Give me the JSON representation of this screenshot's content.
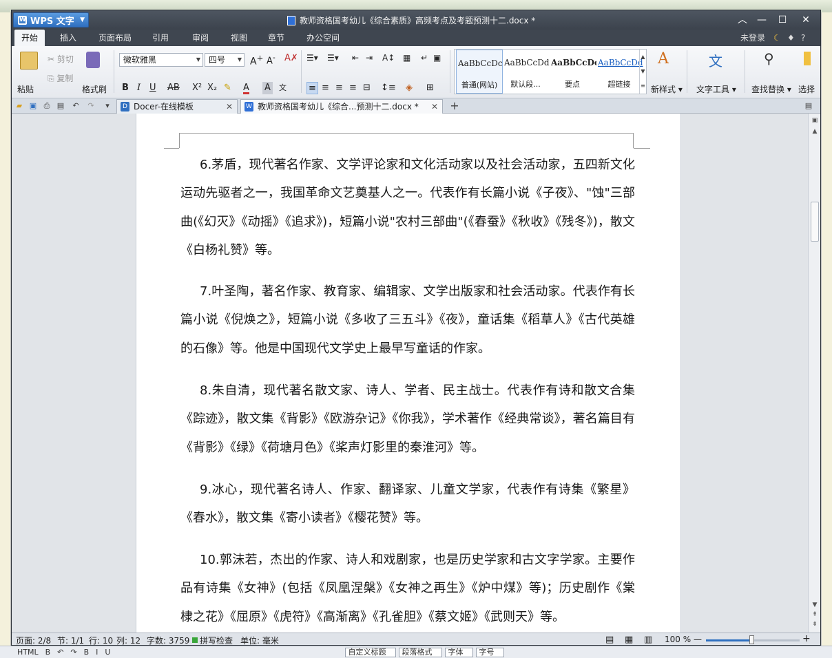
{
  "window": {
    "app_name": "WPS 文字",
    "document_title": "教师资格国考幼儿《综合素质》高频考点及考题预测十二.docx *",
    "minimize_icon": "minimize-icon",
    "maximize_icon": "maximize-icon",
    "close_icon": "close-icon"
  },
  "menu": {
    "items": [
      "开始",
      "插入",
      "页面布局",
      "引用",
      "审阅",
      "视图",
      "章节",
      "办公空间"
    ],
    "active": "开始",
    "login": "未登录",
    "help": "?"
  },
  "ribbon": {
    "paste": "粘贴",
    "cut": "剪切",
    "copy": "复制",
    "format_painter": "格式刷",
    "font_name": "微软雅黑",
    "font_size": "四号",
    "styles": [
      {
        "sample": "AaBbCcDc",
        "label": "普通(网站)"
      },
      {
        "sample": "AaBbCcDd",
        "label": "默认段..."
      },
      {
        "sample": "AaBbCcDc",
        "label": "要点"
      },
      {
        "sample": "AaBbCcDd",
        "label": "超链接"
      }
    ],
    "new_style": "新样式",
    "text_tools": "文字工具",
    "find_replace": "查找替换",
    "select": "选择"
  },
  "tabs": [
    {
      "label": "Docer-在线模板",
      "icon": "docer-icon"
    },
    {
      "label": "教师资格国考幼儿《综合...预测十二.docx *",
      "icon": "wps-doc-icon"
    }
  ],
  "document": {
    "paragraphs": [
      "6.茅盾，现代著名作家、文学评论家和文化活动家以及社会活动家，五四新文化运动先驱者之一，我国革命文艺奠基人之一。代表作有长篇小说《子夜》、\"蚀\"三部曲(《幻灭》《动摇》《追求》)，短篇小说\"农村三部曲\"(《春蚕》《秋收》《残冬》)，散文《白杨礼赞》等。",
      "7.叶圣陶，著名作家、教育家、编辑家、文学出版家和社会活动家。代表作有长篇小说《倪焕之》，短篇小说《多收了三五斗》《夜》，童话集《稻草人》《古代英雄的石像》等。他是中国现代文学史上最早写童话的作家。",
      "8.朱自清，现代著名散文家、诗人、学者、民主战士。代表作有诗和散文合集《踪迹》，散文集《背影》《欧游杂记》《你我》，学术著作《经典常谈》，著名篇目有《背影》《绿》《荷塘月色》《桨声灯影里的秦淮河》等。",
      "9.冰心，现代著名诗人、作家、翻译家、儿童文学家，代表作有诗集《繁星》《春水》，散文集《寄小读者》《樱花赞》等。",
      "10.郭沫若，杰出的作家、诗人和戏剧家，也是历史学家和古文字学家。主要作品有诗集《女神》(包括《凤凰涅槃》《女神之再生》《炉中煤》等)；历史剧作《棠棣之花》《屈原》《虎符》《高渐离》《孔雀胆》《蔡文姬》《武则天》等。"
    ]
  },
  "status": {
    "page": "页面: 2/8",
    "section": "节: 1/1",
    "row": "行: 10",
    "col": "列: 12",
    "word_count": "字数: 3759",
    "spell_check": "拼写检查",
    "unit": "单位: 毫米",
    "zoom": "100 %",
    "zoom_minus": "—",
    "zoom_plus": "+"
  },
  "background_toolbar": {
    "items": [
      "自定义标题",
      "段落格式",
      "字体",
      "字号"
    ]
  },
  "colors": {
    "accent": "#2f6fc0",
    "titlebar": "#3f4650",
    "spell_ok": "#3aa63a"
  }
}
